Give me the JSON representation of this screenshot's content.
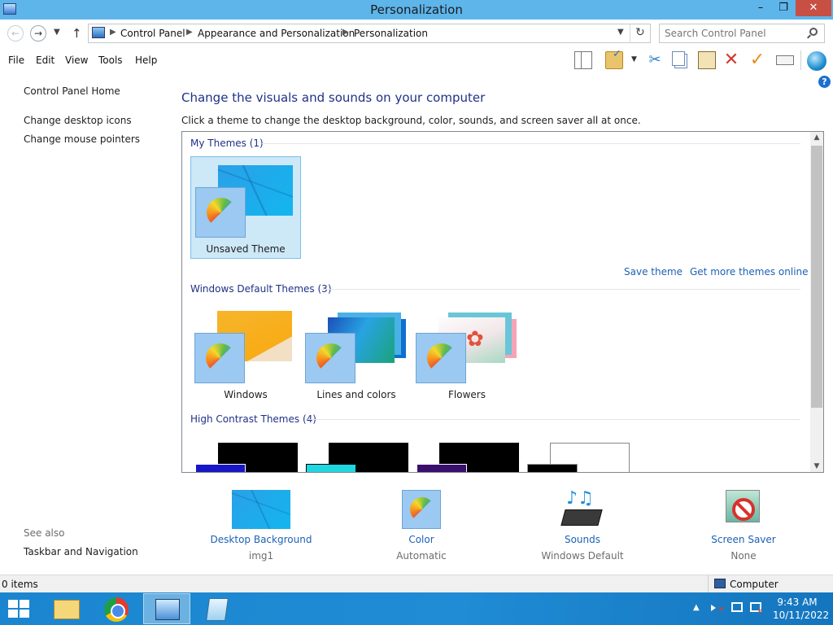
{
  "window": {
    "title": "Personalization",
    "minimize": "–",
    "maximize": "❐",
    "close": "✕"
  },
  "address": {
    "breadcrumbs": [
      "Control Panel",
      "Appearance and Personalization",
      "Personalization"
    ],
    "search_placeholder": "Search Control Panel"
  },
  "menu": [
    "File",
    "Edit",
    "View",
    "Tools",
    "Help"
  ],
  "toolbar_icons": [
    "layout-icon",
    "folder-options-icon",
    "cut-icon",
    "copy-icon",
    "paste-icon",
    "delete-icon",
    "properties-icon",
    "rename-icon",
    "globe-icon"
  ],
  "help_glyph": "?",
  "left_pane": {
    "home": "Control Panel Home",
    "links": [
      "Change desktop icons",
      "Change mouse pointers"
    ],
    "see_also": "See also",
    "see_also_links": [
      "Taskbar and Navigation"
    ]
  },
  "main": {
    "heading": "Change the visuals and sounds on your computer",
    "subtext": "Click a theme to change the desktop background, color, sounds, and screen saver all at once.",
    "groups": [
      {
        "label": "My Themes (1)",
        "themes": [
          "Unsaved Theme"
        ],
        "selected": "Unsaved Theme"
      },
      {
        "label": "Windows Default Themes (3)",
        "themes": [
          "Windows",
          "Lines and colors",
          "Flowers"
        ]
      },
      {
        "label": "High Contrast Themes (4)",
        "themes": []
      }
    ],
    "save_theme": "Save theme",
    "get_more": "Get more themes online"
  },
  "bottom": [
    {
      "label": "Desktop Background",
      "value": "img1"
    },
    {
      "label": "Color",
      "value": "Automatic"
    },
    {
      "label": "Sounds",
      "value": "Windows Default"
    },
    {
      "label": "Screen Saver",
      "value": "None"
    }
  ],
  "status": {
    "items": "0 items",
    "location": "Computer"
  },
  "taskbar": {
    "time": "9:43 AM",
    "date": "10/11/2022"
  },
  "colors": {
    "accent": "#1c61b6",
    "heading": "#1e3287",
    "titlebar": "#5eb5ea",
    "taskbar": "#1f8cd5"
  }
}
